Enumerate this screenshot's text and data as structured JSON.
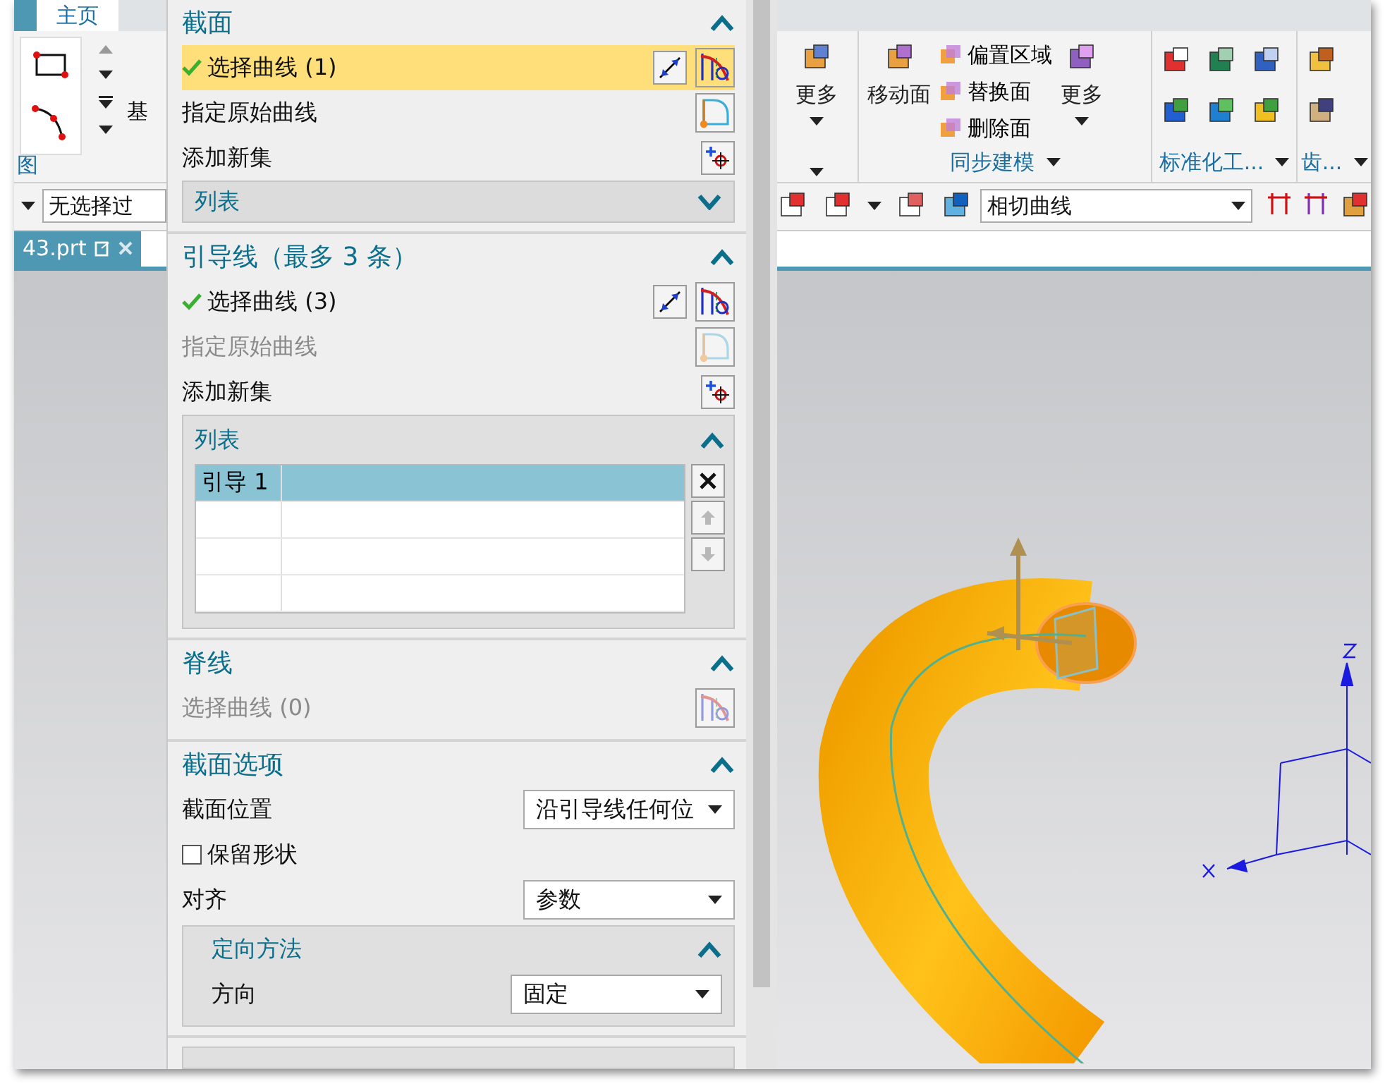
{
  "ribbon": {
    "tabs": [
      {
        "label": "主页",
        "selected": true
      }
    ],
    "left_group": {
      "label": "图",
      "cut_label": "基"
    },
    "sync_group": {
      "more_left": "更多",
      "move_face": "移动面",
      "face_buttons": [
        "偏置区域",
        "替换面",
        "删除面"
      ],
      "more_right": "更多",
      "label": "同步建模"
    },
    "standard_group": {
      "label": "标准化工..."
    },
    "gear_group": {
      "label": "齿..."
    }
  },
  "toolbar": {
    "filter": "无选择过",
    "curve_rule": "相切曲线"
  },
  "document_tab": {
    "label": "43.prt"
  },
  "dialog": {
    "sections": [
      {
        "title": "截面",
        "expanded": true,
        "items": [
          {
            "kind": "select",
            "label": "选择曲线 (1)",
            "done": true,
            "selected": true,
            "disabled": false,
            "reverse_button": true
          },
          {
            "kind": "specify",
            "label": "指定原始曲线",
            "disabled": false
          },
          {
            "kind": "add",
            "label": "添加新集"
          },
          {
            "kind": "list",
            "label": "列表",
            "expanded": false
          }
        ]
      },
      {
        "title": "引导线（最多 3 条）",
        "expanded": true,
        "items": [
          {
            "kind": "select",
            "label": "选择曲线 (3)",
            "done": true,
            "selected": false,
            "disabled": false,
            "reverse_button": true
          },
          {
            "kind": "specify",
            "label": "指定原始曲线",
            "disabled": true
          },
          {
            "kind": "add",
            "label": "添加新集"
          },
          {
            "kind": "list",
            "label": "列表",
            "expanded": true,
            "rows": [
              {
                "label": "引导 1",
                "selected": true
              }
            ]
          }
        ]
      },
      {
        "title": "脊线",
        "expanded": true,
        "items": [
          {
            "kind": "select",
            "label": "选择曲线 (0)",
            "done": false,
            "selected": false,
            "disabled": true,
            "reverse_button": false
          }
        ]
      },
      {
        "title": "截面选项",
        "expanded": true,
        "items": [
          {
            "kind": "dropdown",
            "label": "截面位置",
            "value": "沿引导线任何位"
          },
          {
            "kind": "checkbox",
            "label": "保留形状",
            "checked": false
          },
          {
            "kind": "dropdown",
            "label": "对齐",
            "value": "参数"
          },
          {
            "kind": "subsection",
            "title": "定向方法",
            "expanded": true,
            "items": [
              {
                "kind": "dropdown",
                "label": "方向",
                "value": "固定"
              }
            ]
          }
        ]
      }
    ]
  }
}
